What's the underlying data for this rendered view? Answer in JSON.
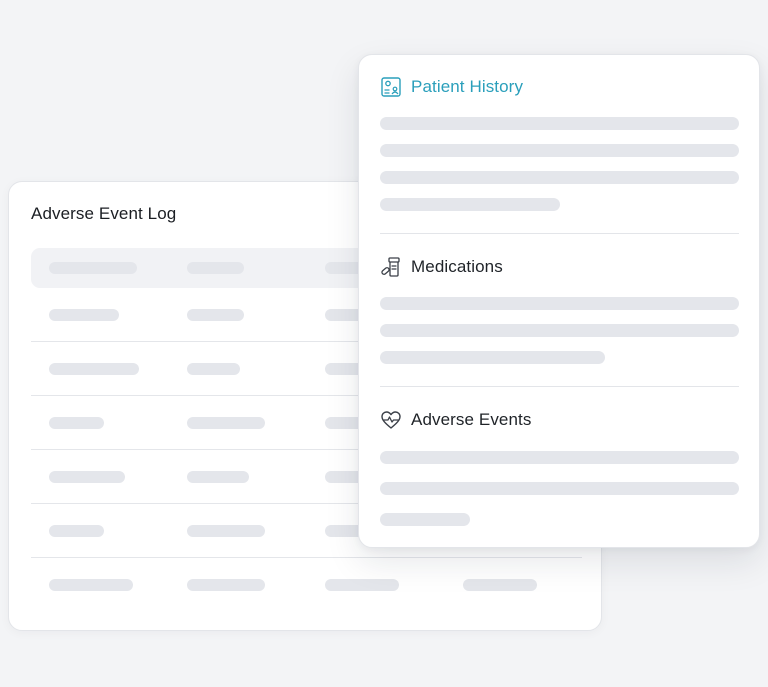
{
  "log_card": {
    "title": "Adverse Event Log",
    "column_count": 4,
    "row_count": 6
  },
  "record_card": {
    "sections": [
      {
        "title": "Patient History",
        "icon": "patient-chart-icon",
        "active": true,
        "placeholder_lines": 4
      },
      {
        "title": "Medications",
        "icon": "medication-icon",
        "active": false,
        "placeholder_lines": 3
      },
      {
        "title": "Adverse Events",
        "icon": "heart-pulse-icon",
        "active": false,
        "placeholder_lines": 3
      }
    ]
  },
  "colors": {
    "accent": "#2a9fbb",
    "text": "#1b1e23",
    "placeholder": "#e4e6eb",
    "background": "#f3f4f6"
  }
}
